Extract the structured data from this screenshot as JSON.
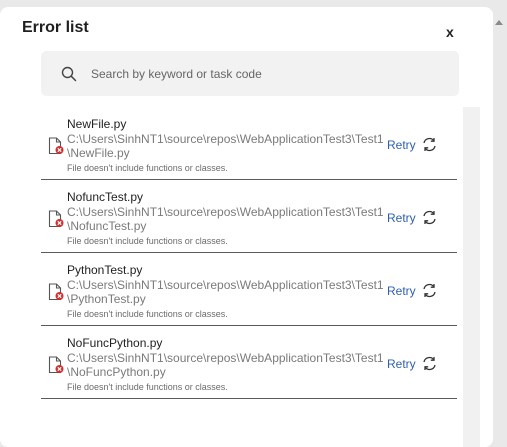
{
  "header": {
    "title": "Error list",
    "close_label": "x"
  },
  "search": {
    "placeholder": "Search by keyword or task code",
    "value": ""
  },
  "items": [
    {
      "name": "NewFile.py",
      "path": "C:\\Users\\SinhNT1\\source\\repos\\WebApplicationTest3\\Test1\\NewFile.py",
      "description": "File doesn't include functions or classes.",
      "retry_label": "Retry"
    },
    {
      "name": "NofuncTest.py",
      "path": "C:\\Users\\SinhNT1\\source\\repos\\WebApplicationTest3\\Test1\\NofuncTest.py",
      "description": "File doesn't include functions or classes.",
      "retry_label": "Retry"
    },
    {
      "name": "PythonTest.py",
      "path": "C:\\Users\\SinhNT1\\source\\repos\\WebApplicationTest3\\Test1\\PythonTest.py",
      "description": "File doesn't include functions or classes.",
      "retry_label": "Retry"
    },
    {
      "name": "NoFuncPython.py",
      "path": "C:\\Users\\SinhNT1\\source\\repos\\WebApplicationTest3\\Test1\\NoFuncPython.py",
      "description": "File doesn't include functions or classes.",
      "retry_label": "Retry"
    }
  ],
  "icons": {
    "search": "search-icon",
    "file_error": "file-error-icon",
    "refresh": "refresh-icon"
  },
  "colors": {
    "retry_link": "#2f5fb0",
    "error_badge": "#d32f2f",
    "path_text": "#7a7a7a"
  }
}
